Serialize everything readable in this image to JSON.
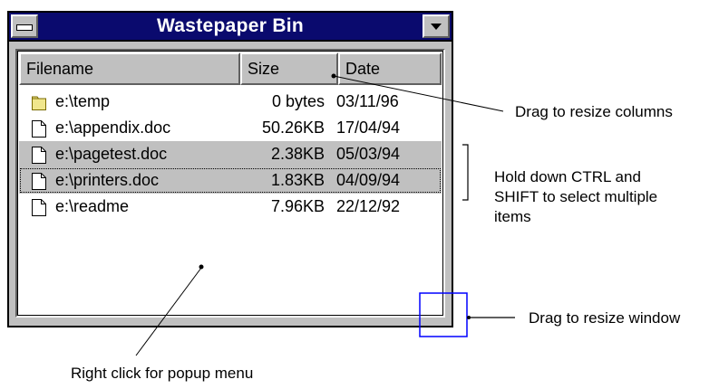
{
  "window": {
    "title": "Wastepaper Bin",
    "columns": {
      "filename": "Filename",
      "size": "Size",
      "date": "Date"
    },
    "files": [
      {
        "name": "e:\\temp",
        "size": "0 bytes",
        "date": "03/11/96",
        "icon": "folder-icon",
        "selected": false,
        "focused": false
      },
      {
        "name": "e:\\appendix.doc",
        "size": "50.26KB",
        "date": "17/04/94",
        "icon": "document-icon",
        "selected": false,
        "focused": false
      },
      {
        "name": "e:\\pagetest.doc",
        "size": "2.38KB",
        "date": "05/03/94",
        "icon": "document-icon",
        "selected": true,
        "focused": false
      },
      {
        "name": "e:\\printers.doc",
        "size": "1.83KB",
        "date": "04/09/94",
        "icon": "document-icon",
        "selected": true,
        "focused": true
      },
      {
        "name": "e:\\readme",
        "size": "7.96KB",
        "date": "22/12/92",
        "icon": "document-icon",
        "selected": false,
        "focused": false
      }
    ]
  },
  "annotations": {
    "resize_columns": "Drag to resize columns",
    "multi_select": [
      "Hold down CTRL and",
      "SHIFT to select multiple",
      "items"
    ],
    "resize_window": "Drag to resize window",
    "popup_menu": "Right click for popup menu"
  },
  "colors": {
    "titlebar": "#0a0a6e",
    "face": "#c0c0c0",
    "resize_box": "#0000ff",
    "folder": "#f0e68c"
  }
}
